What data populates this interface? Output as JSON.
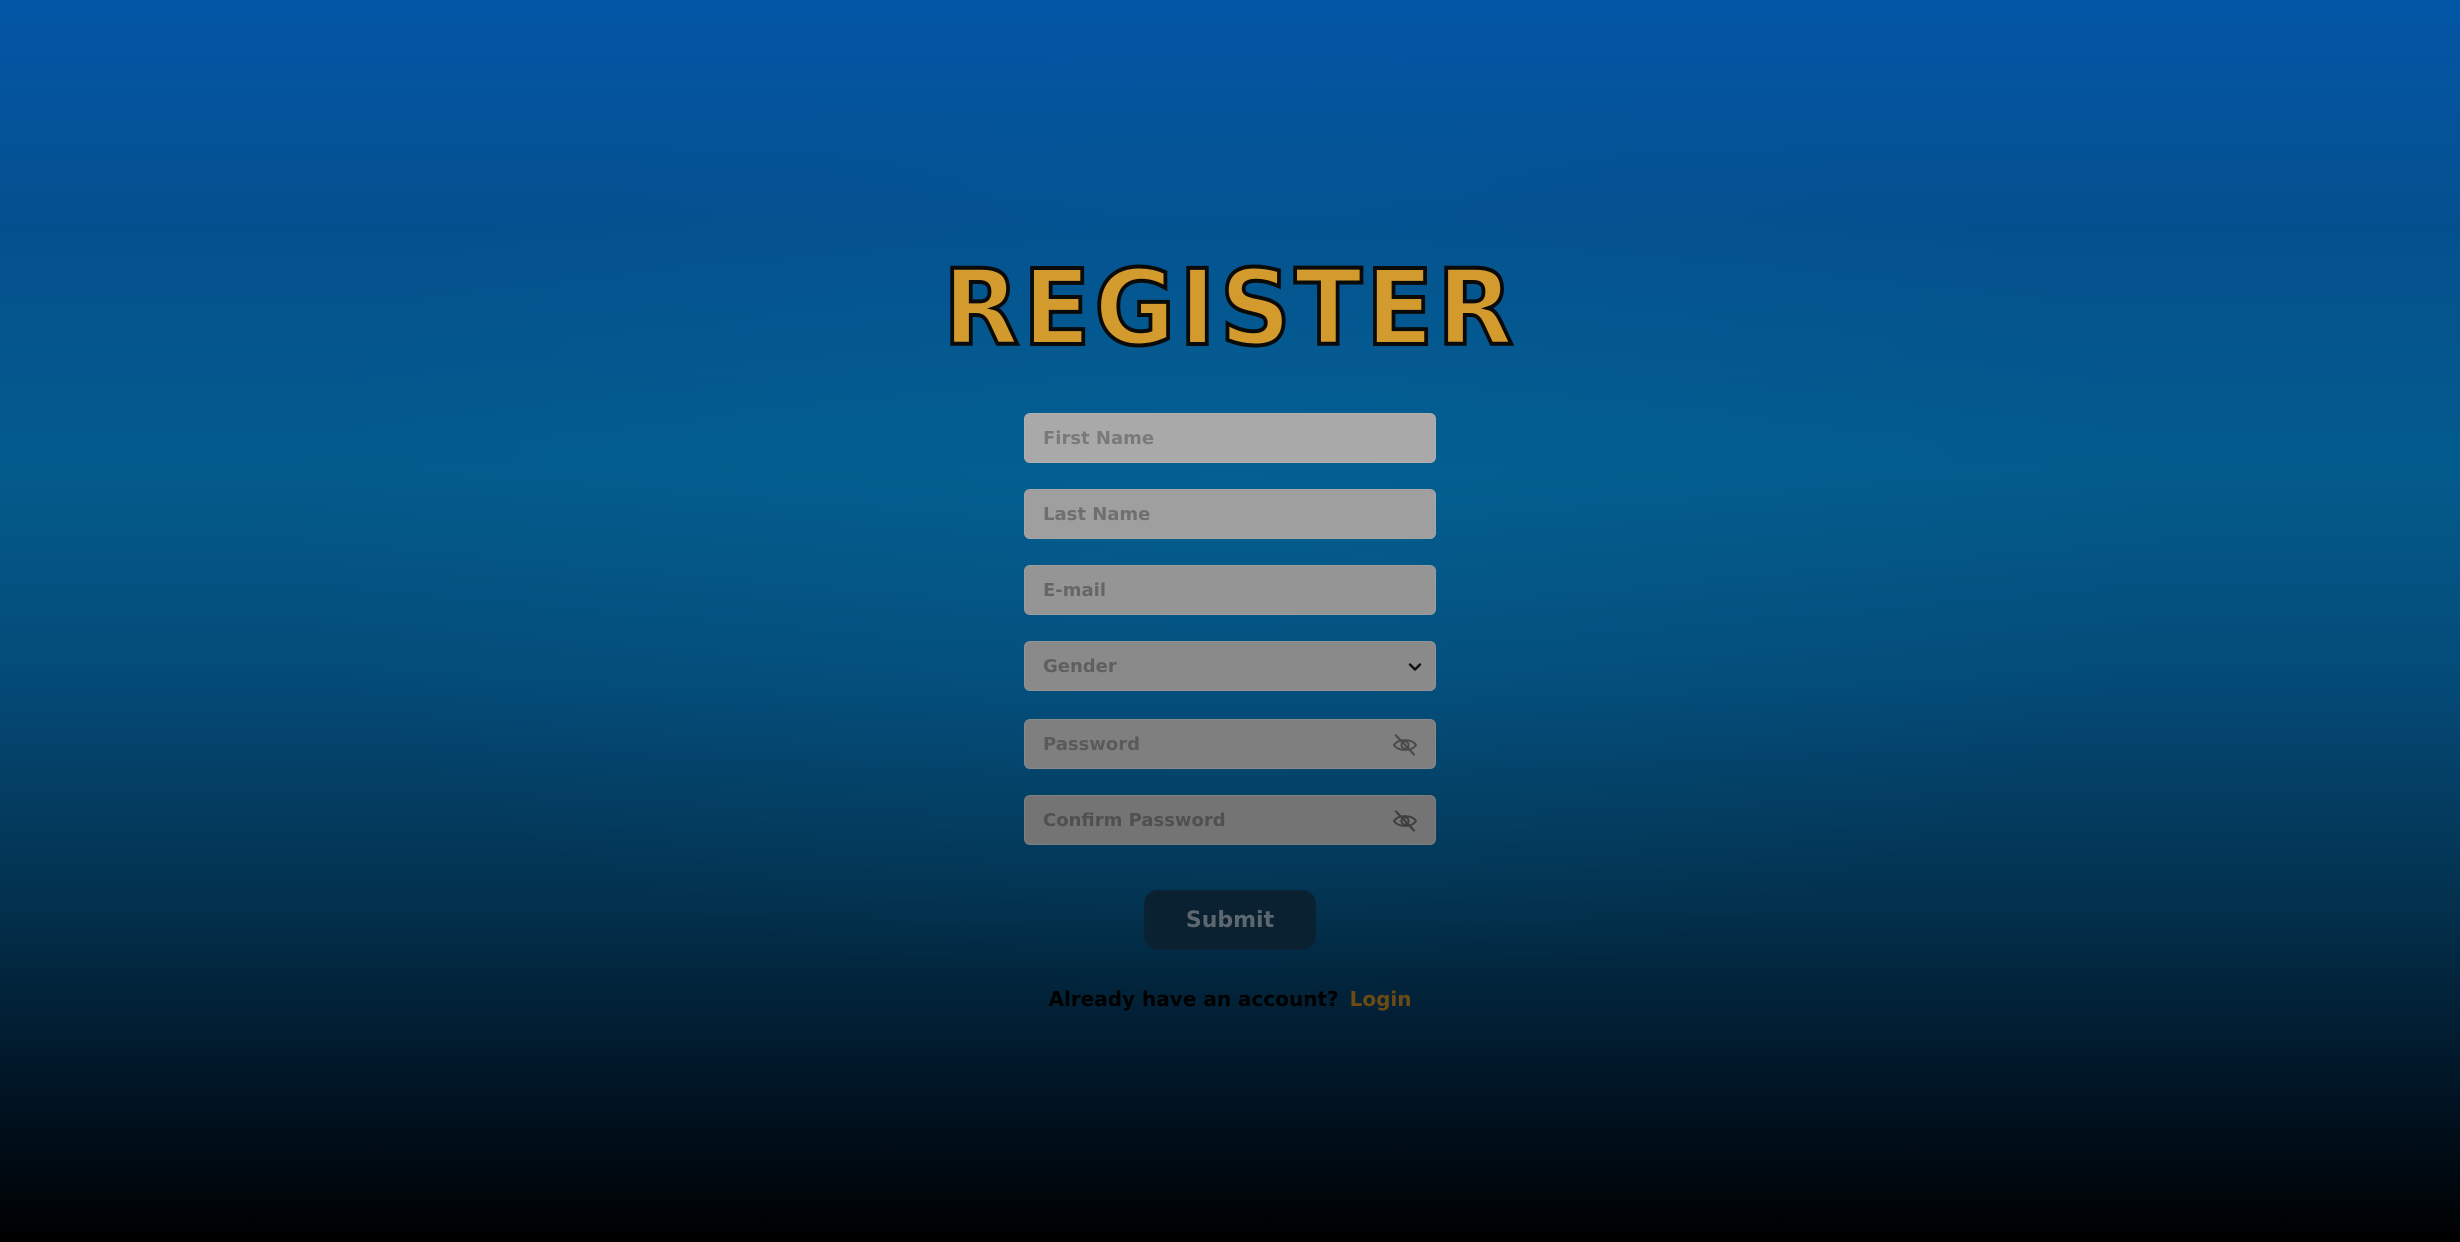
{
  "page": {
    "title": "REGISTER"
  },
  "form": {
    "first_name_placeholder": "First Name",
    "last_name_placeholder": "Last Name",
    "email_placeholder": "E-mail",
    "gender": {
      "selected": "Gender",
      "options": [
        "Gender"
      ]
    },
    "password_placeholder": "Password",
    "confirm_password_placeholder": "Confirm Password",
    "submit_label": "Submit"
  },
  "footer": {
    "prompt": "Already have an account?",
    "login_label": "Login"
  },
  "colors": {
    "title_fill": "#d39a2d",
    "title_outline": "#0a0a0a",
    "background_top": "#0356a6",
    "background_bottom": "#000000",
    "link": "#6b4a14"
  },
  "icons": {
    "gender_select": "chevron-down-icon",
    "password_toggle": "eye-off-icon",
    "confirm_password_toggle": "eye-off-icon"
  }
}
